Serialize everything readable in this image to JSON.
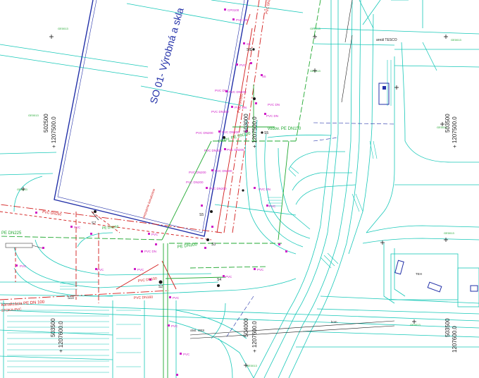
{
  "title": {
    "building": "SO 01- Výrobná a skla"
  },
  "labels": {
    "tesco": "areál TESCO",
    "pipe_pe_dn300": "PE DN300",
    "water_pe_dn150": "vodov. PE DN150",
    "water_pe_dn100": "vodov. PE DN100",
    "pipe_pe_dn225": "PE DN225",
    "pipe_pe_dn250": "PE DN250",
    "kanal_pe_dn100": "kanalizácia PE DN 100",
    "stoka": "STOKA-PVC",
    "pvc_dn200": "PVC DN200",
    "pvc_dn250": "PVC DN250",
    "pvc_dn300": "PVC DN300",
    "pvc_dn150": "PVC DN150",
    "pvc_dn160": "PVC DN160",
    "obs": "obsl. OBS",
    "kom": "kom.",
    "teh": "TEH",
    "kanal_vert": "prepojenie kanalizácie"
  },
  "coords": [
    {
      "text": "502500",
      "rot": -90
    },
    {
      "text": "+ 1207500.0",
      "rot": -90
    },
    {
      "text": "503000",
      "rot": -90
    },
    {
      "text": "+ 1207500.0",
      "rot": -90
    },
    {
      "text": "503500",
      "rot": -90
    },
    {
      "text": "+ 1207500.0",
      "rot": -90
    },
    {
      "text": "503500",
      "rot": -90
    },
    {
      "text": "+ 1207600.0",
      "rot": -90
    },
    {
      "text": "504000",
      "rot": -90
    },
    {
      "text": "+ 1207600.0",
      "rot": -90
    },
    {
      "text": "503500",
      "rot": -90
    },
    {
      "text": "1207600.0",
      "rot": -90
    }
  ],
  "colors": {
    "cyan": "#17c8b8",
    "blue": "#2230a8",
    "red": "#d21c1c",
    "green": "#20a830",
    "magenta": "#d020c8",
    "dark": "#1a1a1a"
  }
}
